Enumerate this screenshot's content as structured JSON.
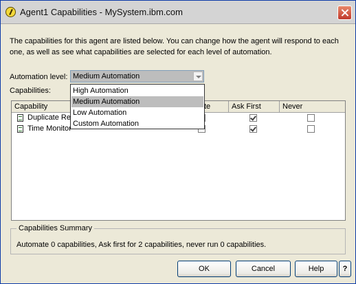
{
  "window": {
    "title": "Agent1 Capabilities - MySystem.ibm.com"
  },
  "intro_text": "The capabilities for this agent are listed below.  You can change how the agent will respond to each one, as well as see what capabilities are selected for each level of automation.",
  "automation": {
    "label": "Automation level:",
    "selected": "Medium Automation",
    "options": [
      "High Automation",
      "Medium Automation",
      "Low Automation",
      "Custom Automation"
    ]
  },
  "capabilities_label": "Capabilities:",
  "table": {
    "columns": [
      "Capability",
      "te",
      "Ask First",
      "Never"
    ],
    "rows": [
      {
        "name": "Duplicate Re",
        "ask_first": true,
        "never": false
      },
      {
        "name": "Time Monitor",
        "ask_first": true,
        "never": false
      }
    ]
  },
  "summary": {
    "legend": "Capabilities Summary",
    "text": "Automate 0 capabilities, Ask first for 2 capabilities, never run 0 capabilities."
  },
  "buttons": {
    "ok": "OK",
    "cancel": "Cancel",
    "help": "Help",
    "context_help": "?"
  }
}
